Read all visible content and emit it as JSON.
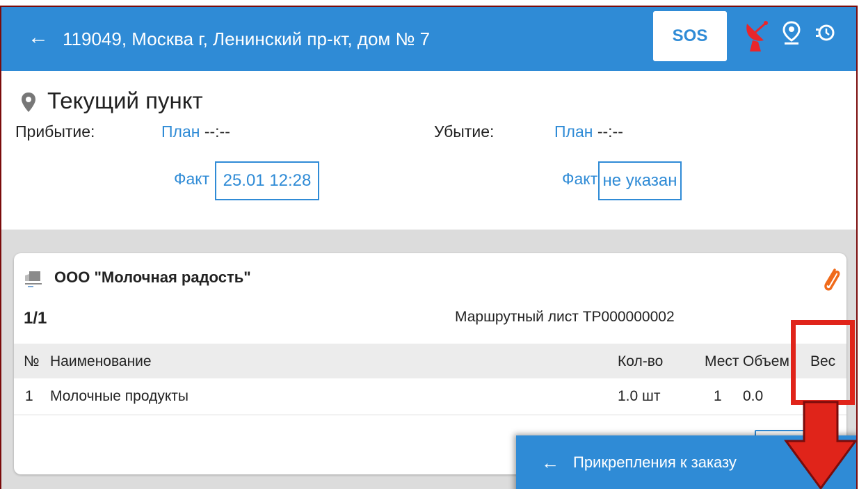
{
  "appbar": {
    "title": "119049, Москва г, Ленинский пр-кт, дом № 7",
    "sos_label": "SOS",
    "color": "#2f8bd6",
    "icons": [
      "arrow-back-icon",
      "satellite-dish-icon",
      "person-pin-icon",
      "history-icon"
    ]
  },
  "current_point": {
    "title": "Текущий пункт",
    "arrival": {
      "label": "Прибытие:",
      "plan_label": "План",
      "plan_value": "--:--",
      "fact_label": "Факт",
      "fact_value": "25.01 12:28"
    },
    "departure": {
      "label": "Убытие:",
      "plan_label": "План",
      "plan_value": "--:--",
      "fact_label": "Факт",
      "fact_value": "не указан"
    }
  },
  "order": {
    "org_name": "ООО \"Молочная радость\"",
    "counter": "1/1",
    "route_sheet": "Маршрутный лист ТР000000002",
    "columns": [
      "№",
      "Наименование",
      "Кол-во",
      "Мест",
      "Объем",
      "Вес"
    ],
    "rows": [
      {
        "num": "1",
        "name": "Молочные продукты",
        "qty": "1.0 шт",
        "places": "1",
        "volume": "0.0"
      }
    ]
  },
  "attachments_sheet": {
    "title": "Прикрепления к заказу"
  },
  "annotation": {
    "highlight_color": "#e0241a"
  }
}
